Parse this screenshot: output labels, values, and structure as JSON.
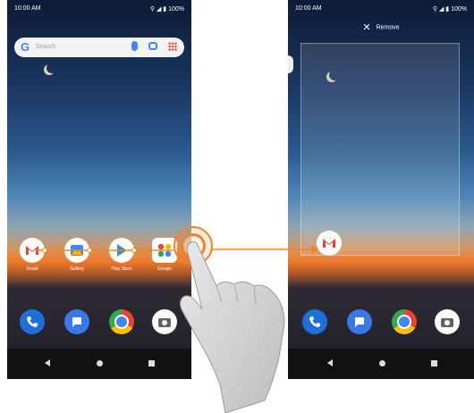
{
  "left_phone": {
    "status": {
      "time": "10:00 AM",
      "system": "⚲ ◢ ▮ 100%"
    },
    "search": {
      "placeholder": "Search"
    },
    "apps": [
      {
        "name": "gmail",
        "label": "Gmail",
        "color": "#ea4335"
      },
      {
        "name": "gallery",
        "label": "Gallery",
        "color": "#4285f4"
      },
      {
        "name": "play-store",
        "label": "Play Store",
        "color": "#34a853"
      },
      {
        "name": "google",
        "label": "Google",
        "color": "#fbbc05"
      }
    ],
    "dock": [
      "phone",
      "messages",
      "chrome",
      "camera"
    ]
  },
  "right_phone": {
    "status": {
      "time": "10:00 AM",
      "system": "⚲ ◢ ▮ 100%"
    },
    "remove": {
      "icon": "close-icon",
      "label": "Remove"
    }
  },
  "colors": {
    "accent": "#f58220",
    "phone_blue": "#1e6fd9",
    "messages_blue": "#3b78e7"
  }
}
